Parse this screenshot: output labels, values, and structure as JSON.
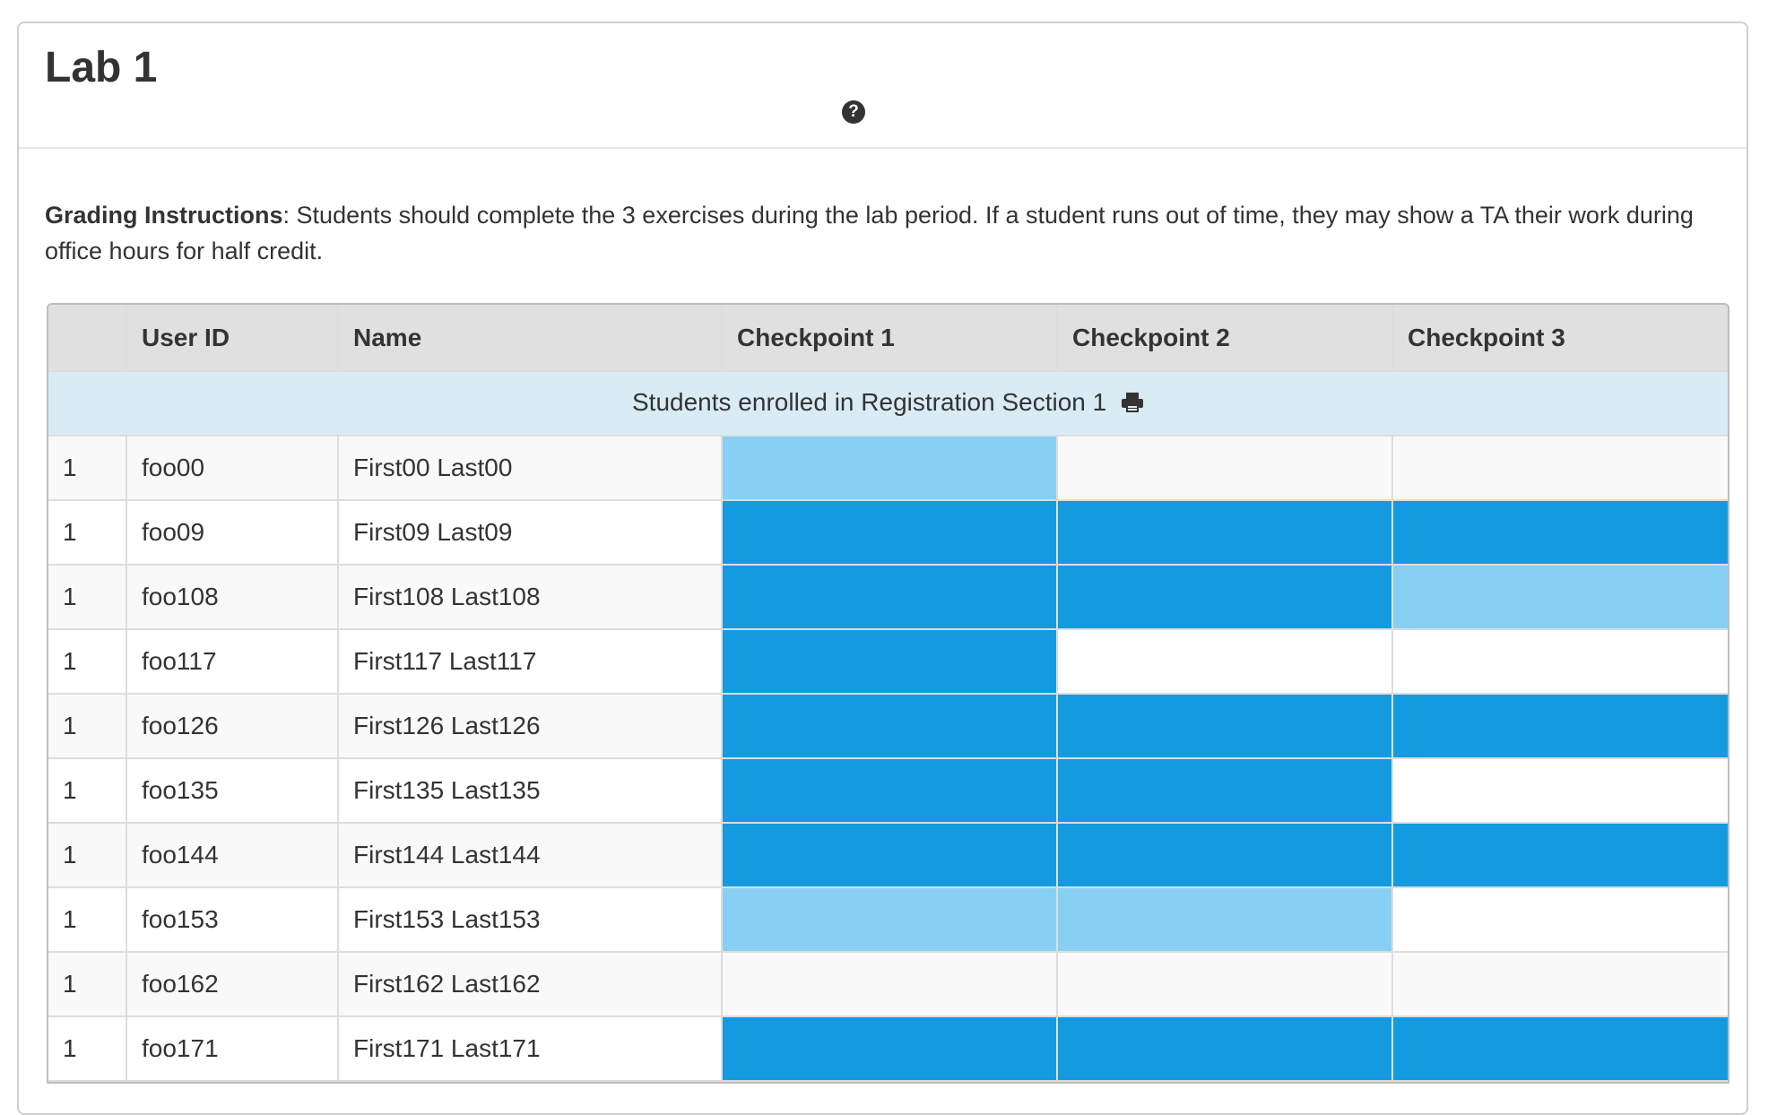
{
  "header": {
    "title": "Lab 1",
    "help_icon": "question-circle-icon"
  },
  "instructions": {
    "label": "Grading Instructions",
    "separator": ":",
    "text": " Students should complete the 3 exercises during the lab period. If a student runs out of time, they may show a TA their work during office hours for half credit."
  },
  "table": {
    "columns": [
      "",
      "User ID",
      "Name",
      "Checkpoint 1",
      "Checkpoint 2",
      "Checkpoint 3"
    ],
    "section_label": "Students enrolled in Registration Section 1",
    "section_icon": "print-icon",
    "status_colors": {
      "full": "#149bdf",
      "partial": "#88d0f3",
      "none": "#ffffff"
    },
    "rows": [
      {
        "section": "1",
        "user_id": "foo00",
        "name": "First00 Last00",
        "checkpoints": [
          "partial",
          "none",
          "none"
        ]
      },
      {
        "section": "1",
        "user_id": "foo09",
        "name": "First09 Last09",
        "checkpoints": [
          "full",
          "full",
          "full"
        ]
      },
      {
        "section": "1",
        "user_id": "foo108",
        "name": "First108 Last108",
        "checkpoints": [
          "full",
          "full",
          "partial"
        ]
      },
      {
        "section": "1",
        "user_id": "foo117",
        "name": "First117 Last117",
        "checkpoints": [
          "full",
          "none",
          "none"
        ]
      },
      {
        "section": "1",
        "user_id": "foo126",
        "name": "First126 Last126",
        "checkpoints": [
          "full",
          "full",
          "full"
        ]
      },
      {
        "section": "1",
        "user_id": "foo135",
        "name": "First135 Last135",
        "checkpoints": [
          "full",
          "full",
          "none"
        ]
      },
      {
        "section": "1",
        "user_id": "foo144",
        "name": "First144 Last144",
        "checkpoints": [
          "full",
          "full",
          "full"
        ]
      },
      {
        "section": "1",
        "user_id": "foo153",
        "name": "First153 Last153",
        "checkpoints": [
          "partial",
          "partial",
          "none"
        ]
      },
      {
        "section": "1",
        "user_id": "foo162",
        "name": "First162 Last162",
        "checkpoints": [
          "none",
          "none",
          "none"
        ]
      },
      {
        "section": "1",
        "user_id": "foo171",
        "name": "First171 Last171",
        "checkpoints": [
          "full",
          "full",
          "full"
        ]
      }
    ]
  }
}
